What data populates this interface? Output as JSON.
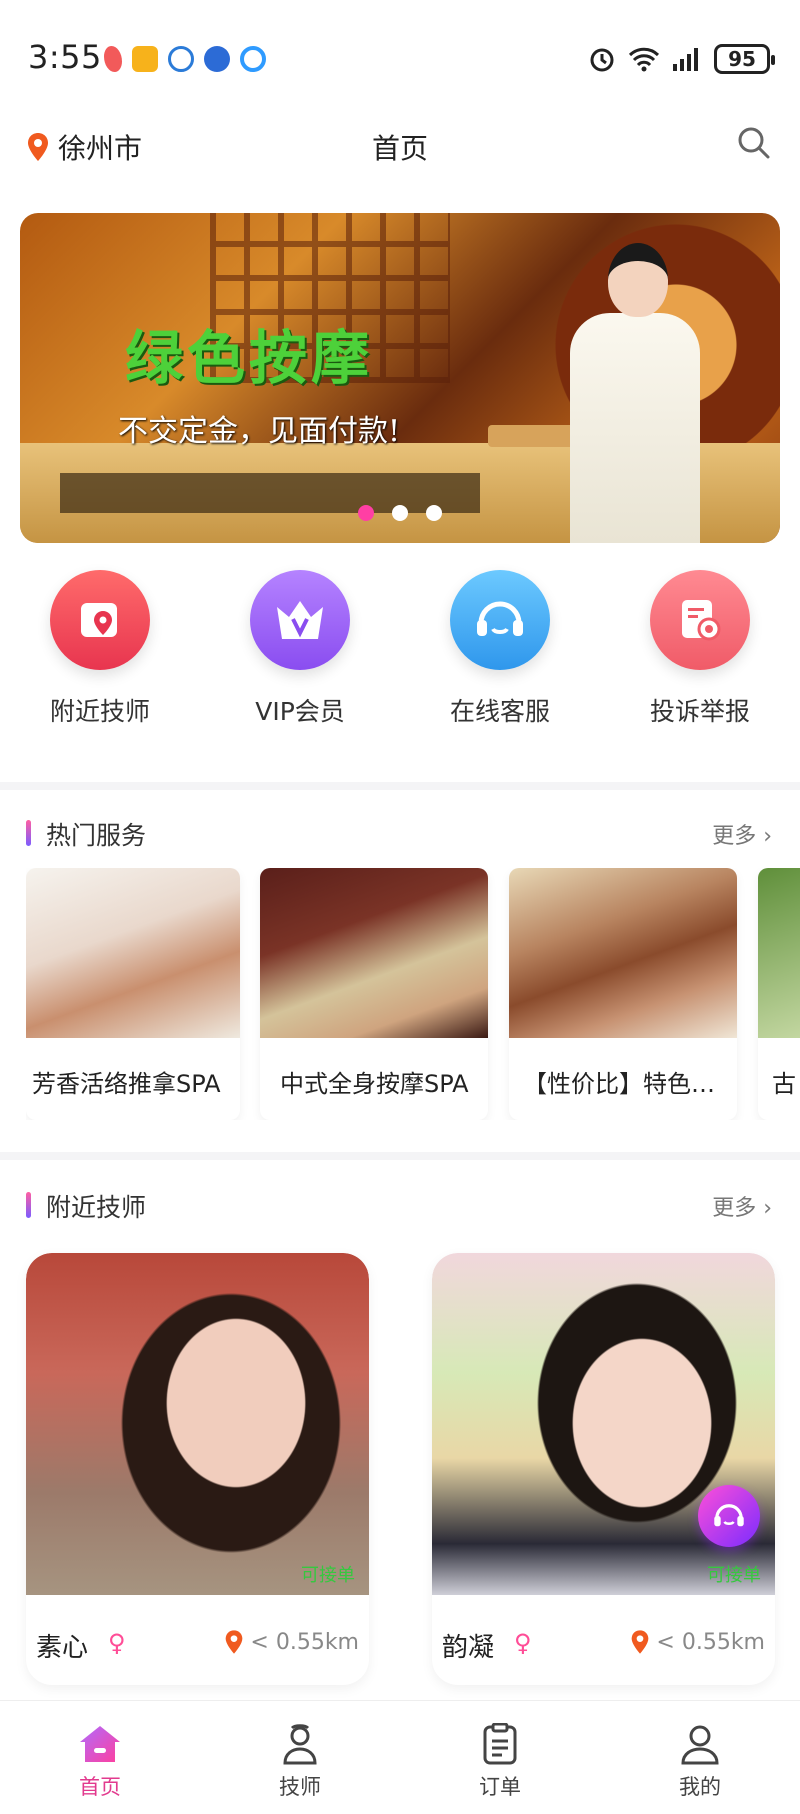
{
  "status_bar": {
    "time": "3:55",
    "battery": "95"
  },
  "header": {
    "city": "徐州市",
    "title": "首页"
  },
  "banner": {
    "title": "绿色按摩",
    "subtitle": "不交定金，见面付款!",
    "dots": 3,
    "active_dot": 0
  },
  "quick_actions": [
    {
      "label": "附近技师",
      "icon": "map-pin-icon",
      "color": "#f0506a"
    },
    {
      "label": "VIP会员",
      "icon": "crown-icon",
      "color": "#9f6bf3"
    },
    {
      "label": "在线客服",
      "icon": "headset-icon",
      "color": "#4fb7f4"
    },
    {
      "label": "投诉举报",
      "icon": "report-icon",
      "color": "#f6737e"
    }
  ],
  "hot_services": {
    "title": "热门服务",
    "more": "更多 ›",
    "items": [
      {
        "name": "芳香活络推拿SPA"
      },
      {
        "name": "中式全身按摩SPA"
      },
      {
        "name": "【性价比】特色…"
      },
      {
        "name": "古"
      }
    ]
  },
  "nearby": {
    "title": "附近技师",
    "more": "更多 ›",
    "technicians": [
      {
        "name": "素心",
        "distance": "< 0.55km",
        "status": "可接单"
      },
      {
        "name": "韵凝",
        "distance": "< 0.55km",
        "status": "可接单"
      }
    ]
  },
  "bottom_nav": [
    {
      "label": "首页",
      "icon": "home-icon",
      "active": true
    },
    {
      "label": "技师",
      "icon": "technician-icon",
      "active": false
    },
    {
      "label": "订单",
      "icon": "orders-icon",
      "active": false
    },
    {
      "label": "我的",
      "icon": "profile-icon",
      "active": false
    }
  ],
  "colors": {
    "accent": "#e23a8e",
    "available": "#36c83f"
  }
}
